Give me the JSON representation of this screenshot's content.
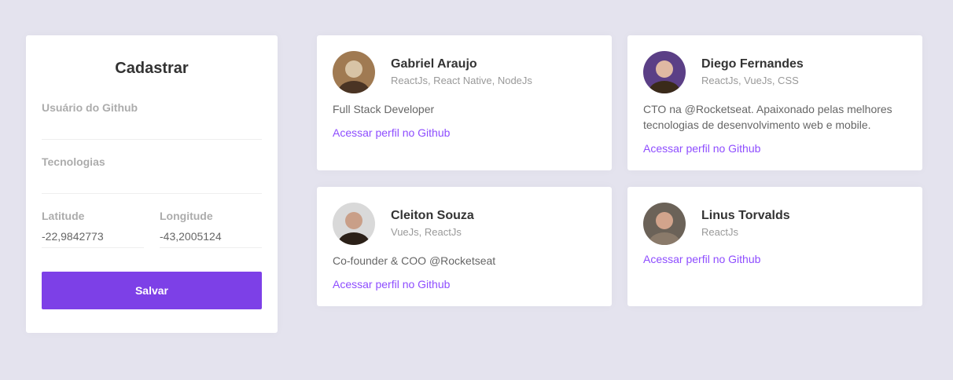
{
  "form": {
    "title": "Cadastrar",
    "github_label": "Usuário do Github",
    "github_value": "",
    "techs_label": "Tecnologias",
    "techs_value": "",
    "latitude_label": "Latitude",
    "latitude_value": "-22,9842773",
    "longitude_label": "Longitude",
    "longitude_value": "-43,2005124",
    "save_label": "Salvar"
  },
  "devs": [
    {
      "name": "Gabriel Araujo",
      "techs": "ReactJs, React Native, NodeJs",
      "bio": "Full Stack Developer",
      "link": "Acessar perfil no Github",
      "avatar_colors": [
        "#a07a52",
        "#d8c4a6",
        "#4a3424"
      ]
    },
    {
      "name": "Diego Fernandes",
      "techs": "ReactJs, VueJs, CSS",
      "bio": "CTO na @Rocketseat. Apaixonado pelas melhores tecnologias de desenvolvimento web e mobile.",
      "link": "Acessar perfil no Github",
      "avatar_colors": [
        "#5b3f86",
        "#e0b9a3",
        "#3a2a1a"
      ]
    },
    {
      "name": "Cleiton Souza",
      "techs": "VueJs, ReactJs",
      "bio": "Co-founder & COO @Rocketseat",
      "link": "Acessar perfil no Github",
      "avatar_colors": [
        "#d9d9d9",
        "#c99f88",
        "#2b2018"
      ]
    },
    {
      "name": "Linus Torvalds",
      "techs": "ReactJs",
      "bio": "",
      "link": "Acessar perfil no Github",
      "avatar_colors": [
        "#6b6258",
        "#d2a48c",
        "#8a7a6a"
      ]
    }
  ],
  "colors": {
    "background": "#e4e3ee",
    "accent": "#7d40e7",
    "link": "#8e4dff"
  }
}
